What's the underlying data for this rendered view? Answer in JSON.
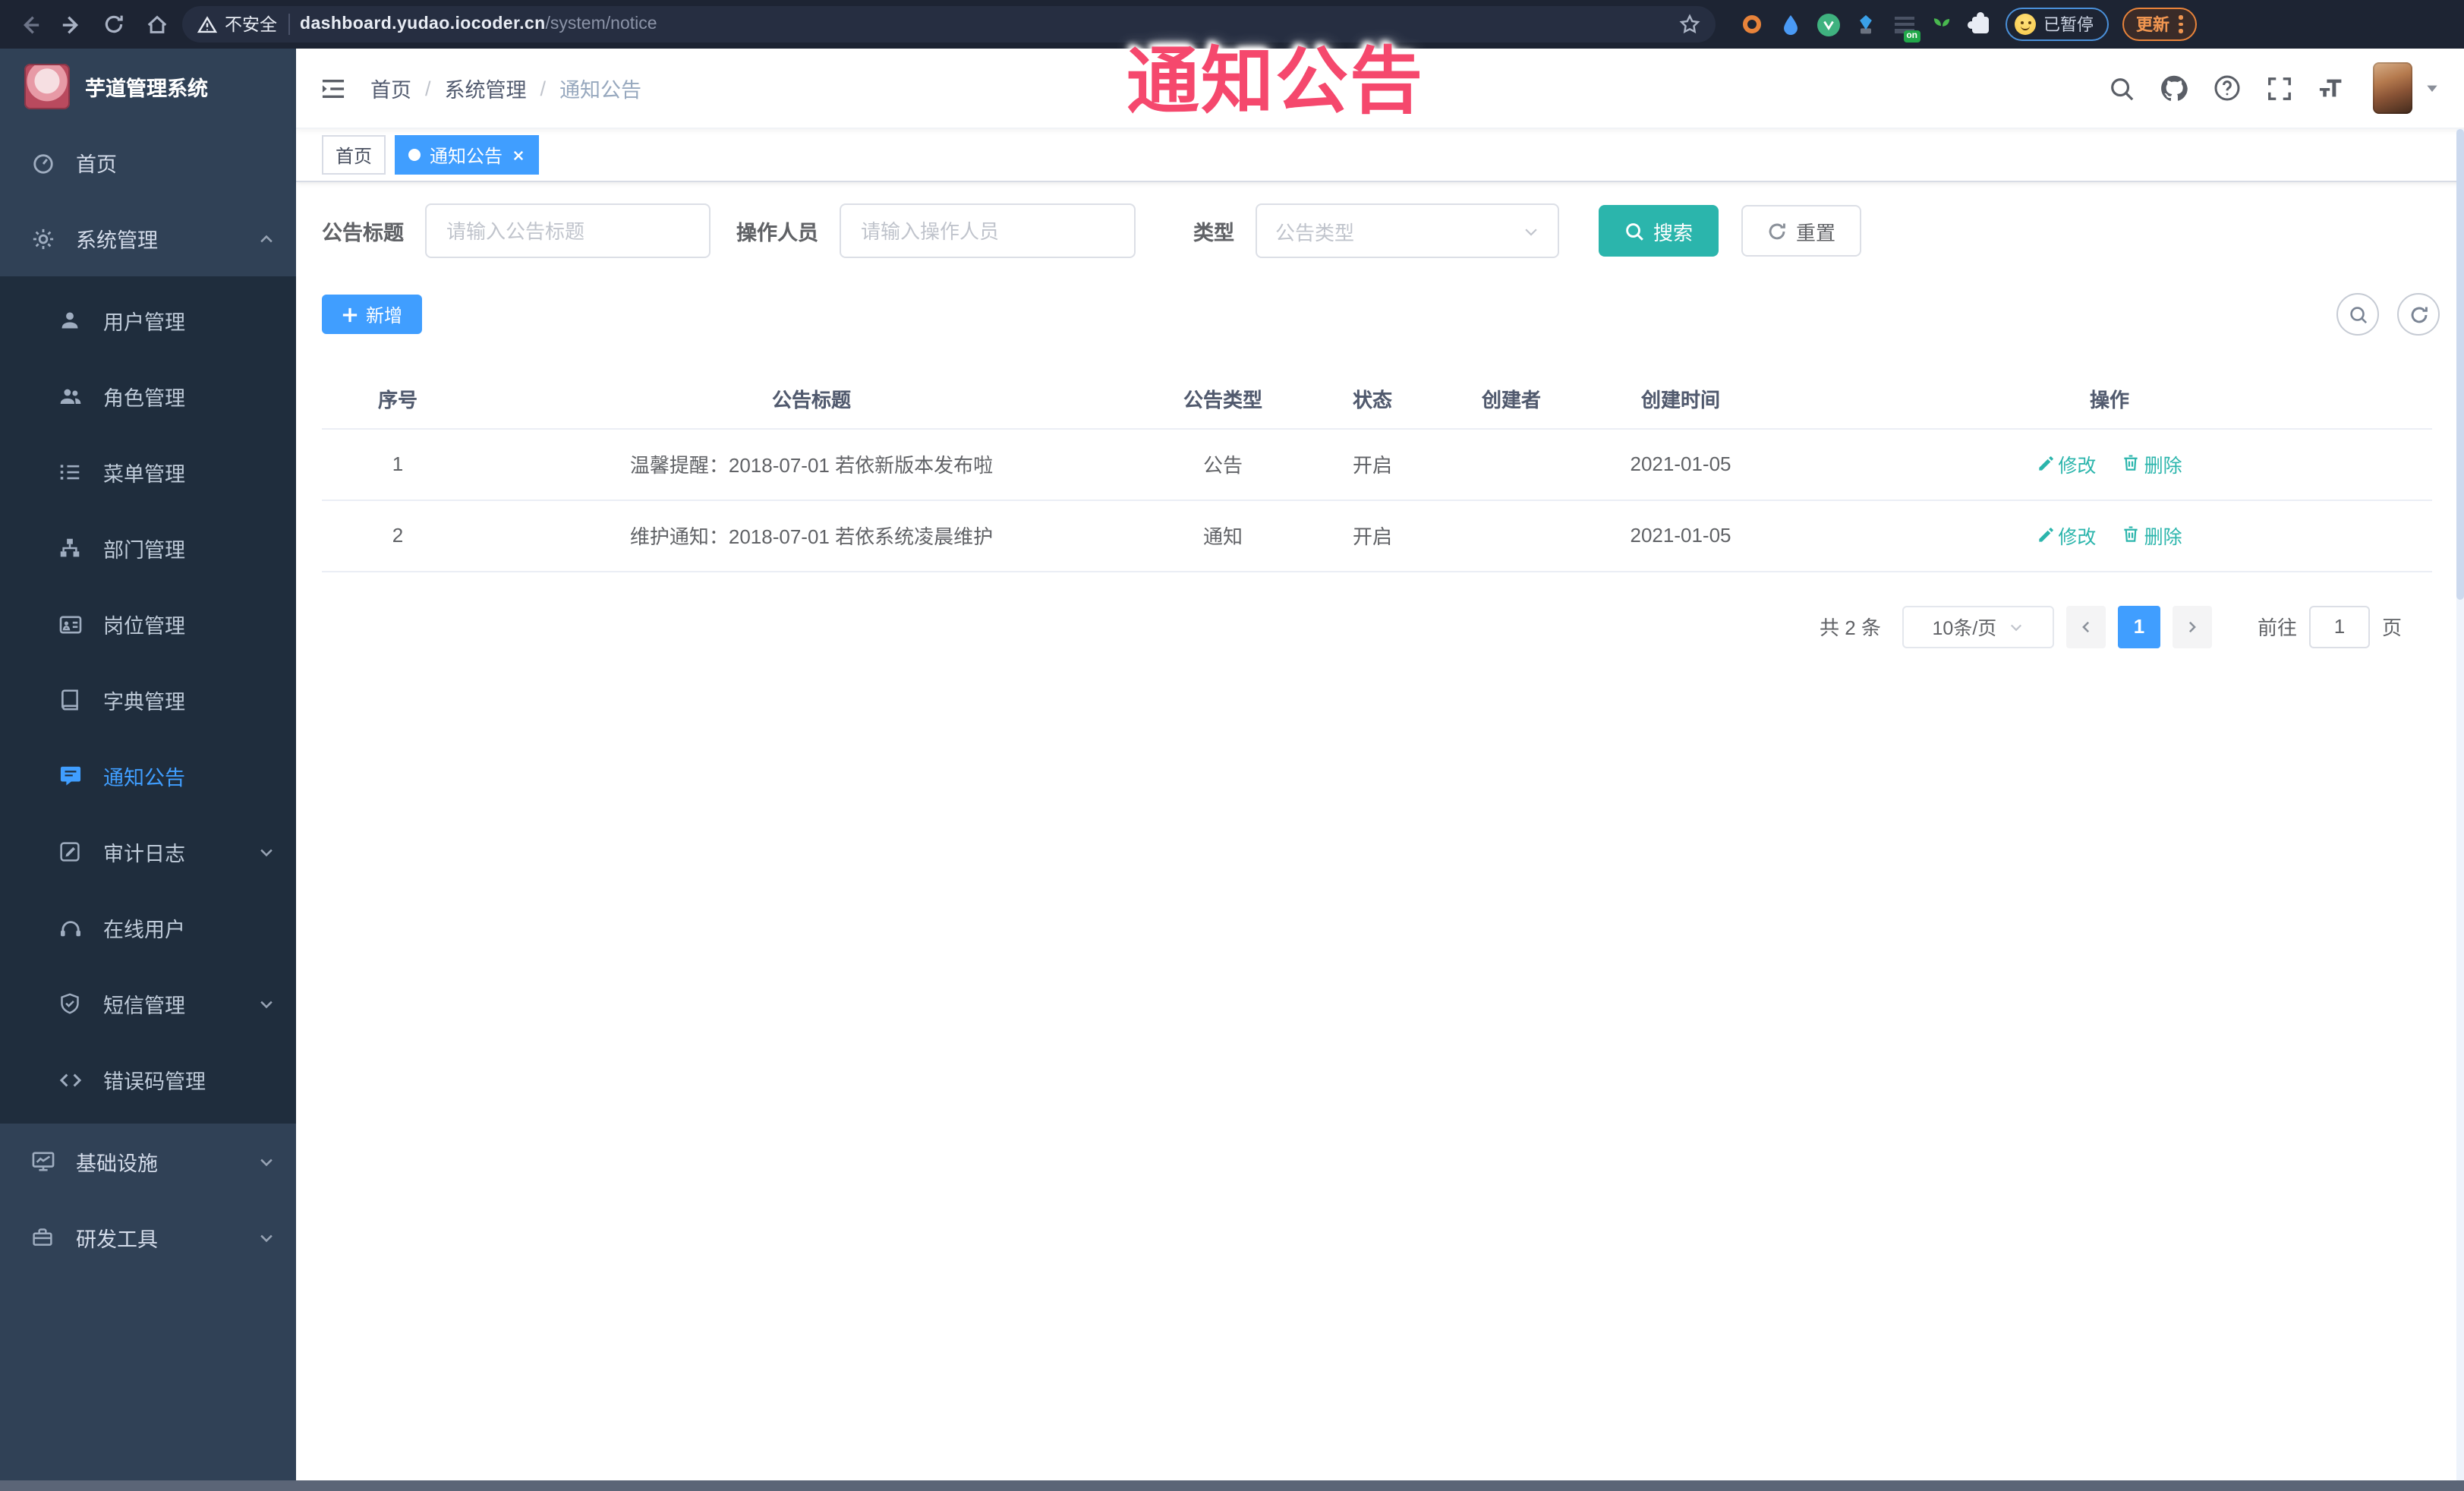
{
  "watermark": "通知公告",
  "browser": {
    "security_label": "不安全",
    "url_host": "dashboard.yudao.iocoder.cn",
    "url_path": "/system/notice",
    "ext_on_badge": "on",
    "paused_label": "已暂停",
    "update_label": "更新"
  },
  "sidebar": {
    "app_title": "芋道管理系统",
    "items": [
      {
        "label": "首页"
      },
      {
        "label": "系统管理"
      },
      {
        "label": "用户管理"
      },
      {
        "label": "角色管理"
      },
      {
        "label": "菜单管理"
      },
      {
        "label": "部门管理"
      },
      {
        "label": "岗位管理"
      },
      {
        "label": "字典管理"
      },
      {
        "label": "通知公告"
      },
      {
        "label": "审计日志"
      },
      {
        "label": "在线用户"
      },
      {
        "label": "短信管理"
      },
      {
        "label": "错误码管理"
      },
      {
        "label": "基础设施"
      },
      {
        "label": "研发工具"
      }
    ]
  },
  "navbar": {
    "breadcrumb": [
      "首页",
      "系统管理",
      "通知公告"
    ]
  },
  "tags": [
    {
      "label": "首页"
    },
    {
      "label": "通知公告"
    }
  ],
  "filters": {
    "title_label": "公告标题",
    "title_placeholder": "请输入公告标题",
    "operator_label": "操作人员",
    "operator_placeholder": "请输入操作人员",
    "type_label": "类型",
    "type_placeholder": "公告类型",
    "search_label": "搜索",
    "reset_label": "重置"
  },
  "toolbar": {
    "add_label": "新增"
  },
  "table": {
    "columns": [
      "序号",
      "公告标题",
      "公告类型",
      "状态",
      "创建者",
      "创建时间",
      "操作"
    ],
    "rows": [
      {
        "no": "1",
        "title": "温馨提醒：2018-07-01 若依新版本发布啦",
        "type": "公告",
        "status": "开启",
        "creator": "",
        "create_time": "2021-01-05",
        "edit_label": "修改",
        "delete_label": "删除"
      },
      {
        "no": "2",
        "title": "维护通知：2018-07-01 若依系统凌晨维护",
        "type": "通知",
        "status": "开启",
        "creator": "",
        "create_time": "2021-01-05",
        "edit_label": "修改",
        "delete_label": "删除"
      }
    ]
  },
  "pagination": {
    "total": "共 2 条",
    "page_size": "10条/页",
    "current_page": "1",
    "goto_label": "前往",
    "goto_value": "1",
    "unit_label": "页"
  },
  "colors": {
    "primary": "#409eff",
    "teal": "#2bb5ac",
    "sidebar_bg": "#304156",
    "submenu_bg": "#1f2d3d",
    "browser_bg": "#1d2433",
    "watermark_color": "#f5486d",
    "active_tag": "#409eff"
  }
}
